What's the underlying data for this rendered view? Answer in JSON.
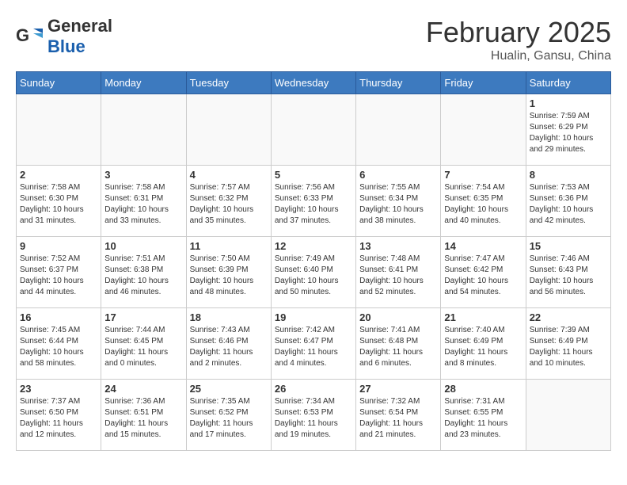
{
  "logo": {
    "general": "General",
    "blue": "Blue"
  },
  "title": "February 2025",
  "subtitle": "Hualin, Gansu, China",
  "weekdays": [
    "Sunday",
    "Monday",
    "Tuesday",
    "Wednesday",
    "Thursday",
    "Friday",
    "Saturday"
  ],
  "weeks": [
    [
      {
        "day": "",
        "info": ""
      },
      {
        "day": "",
        "info": ""
      },
      {
        "day": "",
        "info": ""
      },
      {
        "day": "",
        "info": ""
      },
      {
        "day": "",
        "info": ""
      },
      {
        "day": "",
        "info": ""
      },
      {
        "day": "1",
        "info": "Sunrise: 7:59 AM\nSunset: 6:29 PM\nDaylight: 10 hours\nand 29 minutes."
      }
    ],
    [
      {
        "day": "2",
        "info": "Sunrise: 7:58 AM\nSunset: 6:30 PM\nDaylight: 10 hours\nand 31 minutes."
      },
      {
        "day": "3",
        "info": "Sunrise: 7:58 AM\nSunset: 6:31 PM\nDaylight: 10 hours\nand 33 minutes."
      },
      {
        "day": "4",
        "info": "Sunrise: 7:57 AM\nSunset: 6:32 PM\nDaylight: 10 hours\nand 35 minutes."
      },
      {
        "day": "5",
        "info": "Sunrise: 7:56 AM\nSunset: 6:33 PM\nDaylight: 10 hours\nand 37 minutes."
      },
      {
        "day": "6",
        "info": "Sunrise: 7:55 AM\nSunset: 6:34 PM\nDaylight: 10 hours\nand 38 minutes."
      },
      {
        "day": "7",
        "info": "Sunrise: 7:54 AM\nSunset: 6:35 PM\nDaylight: 10 hours\nand 40 minutes."
      },
      {
        "day": "8",
        "info": "Sunrise: 7:53 AM\nSunset: 6:36 PM\nDaylight: 10 hours\nand 42 minutes."
      }
    ],
    [
      {
        "day": "9",
        "info": "Sunrise: 7:52 AM\nSunset: 6:37 PM\nDaylight: 10 hours\nand 44 minutes."
      },
      {
        "day": "10",
        "info": "Sunrise: 7:51 AM\nSunset: 6:38 PM\nDaylight: 10 hours\nand 46 minutes."
      },
      {
        "day": "11",
        "info": "Sunrise: 7:50 AM\nSunset: 6:39 PM\nDaylight: 10 hours\nand 48 minutes."
      },
      {
        "day": "12",
        "info": "Sunrise: 7:49 AM\nSunset: 6:40 PM\nDaylight: 10 hours\nand 50 minutes."
      },
      {
        "day": "13",
        "info": "Sunrise: 7:48 AM\nSunset: 6:41 PM\nDaylight: 10 hours\nand 52 minutes."
      },
      {
        "day": "14",
        "info": "Sunrise: 7:47 AM\nSunset: 6:42 PM\nDaylight: 10 hours\nand 54 minutes."
      },
      {
        "day": "15",
        "info": "Sunrise: 7:46 AM\nSunset: 6:43 PM\nDaylight: 10 hours\nand 56 minutes."
      }
    ],
    [
      {
        "day": "16",
        "info": "Sunrise: 7:45 AM\nSunset: 6:44 PM\nDaylight: 10 hours\nand 58 minutes."
      },
      {
        "day": "17",
        "info": "Sunrise: 7:44 AM\nSunset: 6:45 PM\nDaylight: 11 hours\nand 0 minutes."
      },
      {
        "day": "18",
        "info": "Sunrise: 7:43 AM\nSunset: 6:46 PM\nDaylight: 11 hours\nand 2 minutes."
      },
      {
        "day": "19",
        "info": "Sunrise: 7:42 AM\nSunset: 6:47 PM\nDaylight: 11 hours\nand 4 minutes."
      },
      {
        "day": "20",
        "info": "Sunrise: 7:41 AM\nSunset: 6:48 PM\nDaylight: 11 hours\nand 6 minutes."
      },
      {
        "day": "21",
        "info": "Sunrise: 7:40 AM\nSunset: 6:49 PM\nDaylight: 11 hours\nand 8 minutes."
      },
      {
        "day": "22",
        "info": "Sunrise: 7:39 AM\nSunset: 6:49 PM\nDaylight: 11 hours\nand 10 minutes."
      }
    ],
    [
      {
        "day": "23",
        "info": "Sunrise: 7:37 AM\nSunset: 6:50 PM\nDaylight: 11 hours\nand 12 minutes."
      },
      {
        "day": "24",
        "info": "Sunrise: 7:36 AM\nSunset: 6:51 PM\nDaylight: 11 hours\nand 15 minutes."
      },
      {
        "day": "25",
        "info": "Sunrise: 7:35 AM\nSunset: 6:52 PM\nDaylight: 11 hours\nand 17 minutes."
      },
      {
        "day": "26",
        "info": "Sunrise: 7:34 AM\nSunset: 6:53 PM\nDaylight: 11 hours\nand 19 minutes."
      },
      {
        "day": "27",
        "info": "Sunrise: 7:32 AM\nSunset: 6:54 PM\nDaylight: 11 hours\nand 21 minutes."
      },
      {
        "day": "28",
        "info": "Sunrise: 7:31 AM\nSunset: 6:55 PM\nDaylight: 11 hours\nand 23 minutes."
      },
      {
        "day": "",
        "info": ""
      }
    ]
  ]
}
